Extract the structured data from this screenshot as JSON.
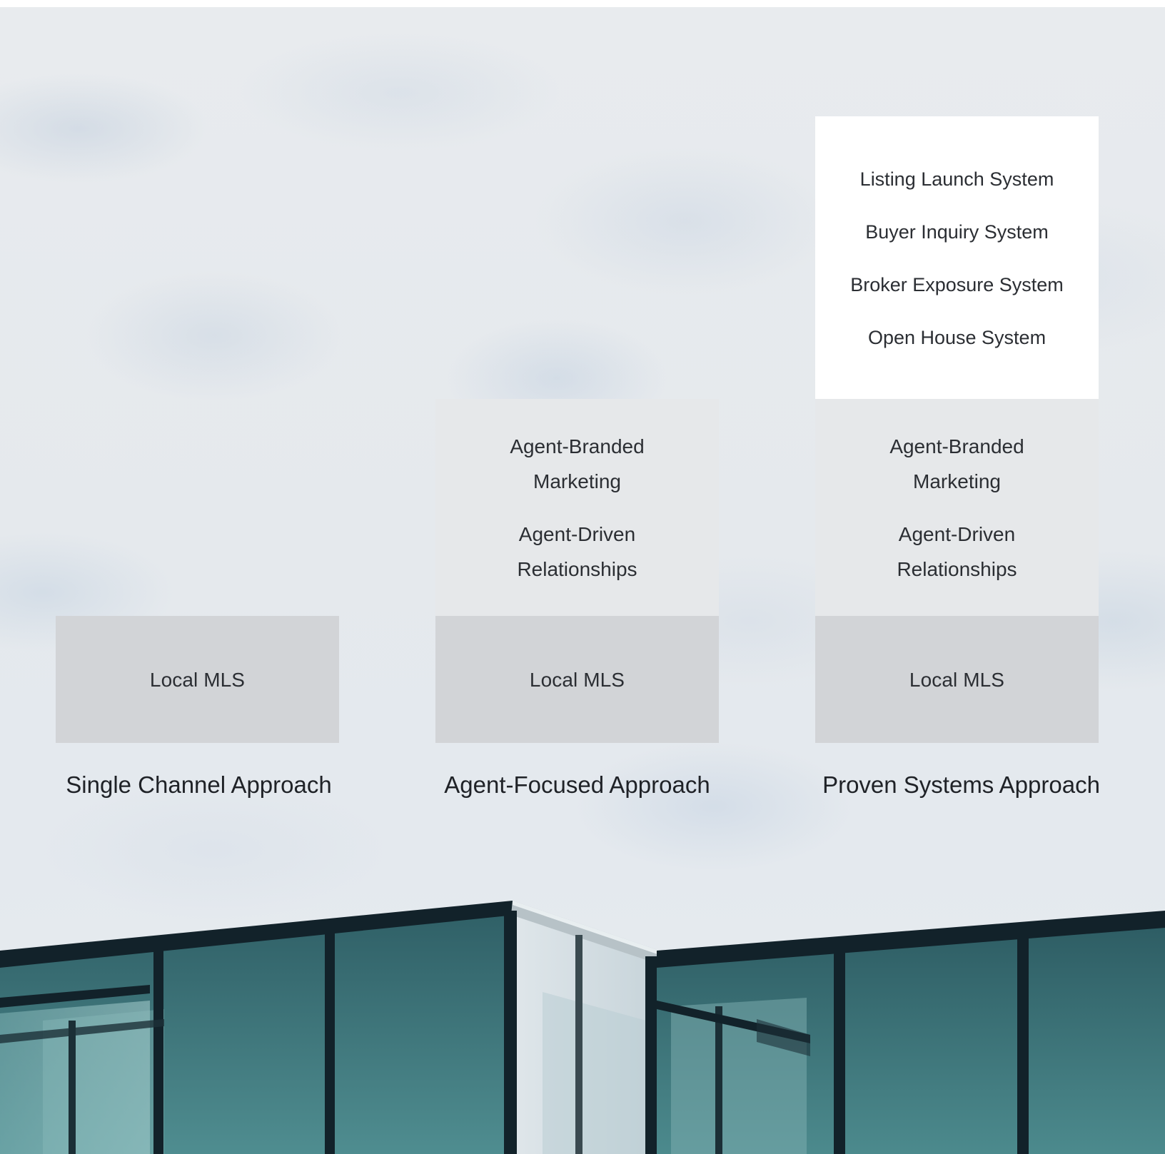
{
  "approaches": [
    {
      "caption": "Single Channel Approach",
      "base": "Local MLS"
    },
    {
      "caption": "Agent-Focused Approach",
      "base": "Local MLS",
      "mid": [
        "Agent-Branded Marketing",
        "Agent-Driven Relationships"
      ]
    },
    {
      "caption": "Proven Systems Approach",
      "base": "Local MLS",
      "mid": [
        "Agent-Branded Marketing",
        "Agent-Driven Relationships"
      ],
      "top": [
        "Listing Launch System",
        "Buyer Inquiry System",
        "Broker Exposure System",
        "Open House System"
      ]
    }
  ],
  "colors": {
    "base_block": "#d2d4d7",
    "mid_block": "#e6e8ea",
    "top_block": "#ffffff",
    "text": "#2b2e33",
    "glass": "#3f7479",
    "frame": "#13232b"
  }
}
